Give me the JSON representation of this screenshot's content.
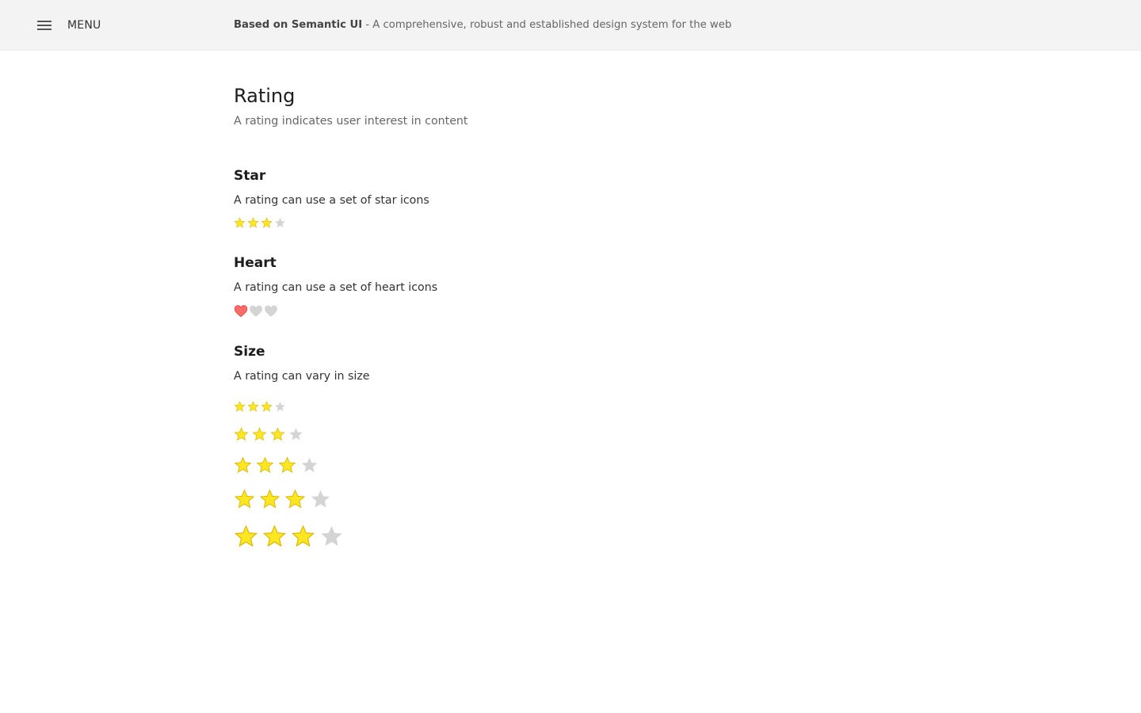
{
  "header": {
    "menu_label": "MENU",
    "brand": "Based on Semantic UI",
    "tagline": " - A comprehensive, robust and established design system for the web"
  },
  "page": {
    "title": "Rating",
    "subtitle": "A rating indicates user interest in content"
  },
  "colors": {
    "star_active": "#ffe623",
    "star_active_stroke": "#d9b800",
    "heart_active": "#ff6b6b",
    "heart_active_stroke": "#c93a3a",
    "inactive": "#d4d4d4"
  },
  "sections": {
    "star": {
      "title": "Star",
      "description": "A rating can use a set of star icons",
      "icon": "star-icon",
      "rating": 3,
      "max": 4
    },
    "heart": {
      "title": "Heart",
      "description": "A rating can use a set of heart icons",
      "icon": "heart-icon",
      "rating": 1,
      "max": 3
    },
    "size": {
      "title": "Size",
      "description": "A rating can vary in size",
      "icon": "star-icon",
      "variants": [
        {
          "size": "mini",
          "rating": 3,
          "max": 4
        },
        {
          "size": "small",
          "rating": 3,
          "max": 4
        },
        {
          "size": "medium",
          "rating": 3,
          "max": 4
        },
        {
          "size": "large",
          "rating": 3,
          "max": 4
        },
        {
          "size": "huge",
          "rating": 3,
          "max": 4
        }
      ]
    }
  }
}
